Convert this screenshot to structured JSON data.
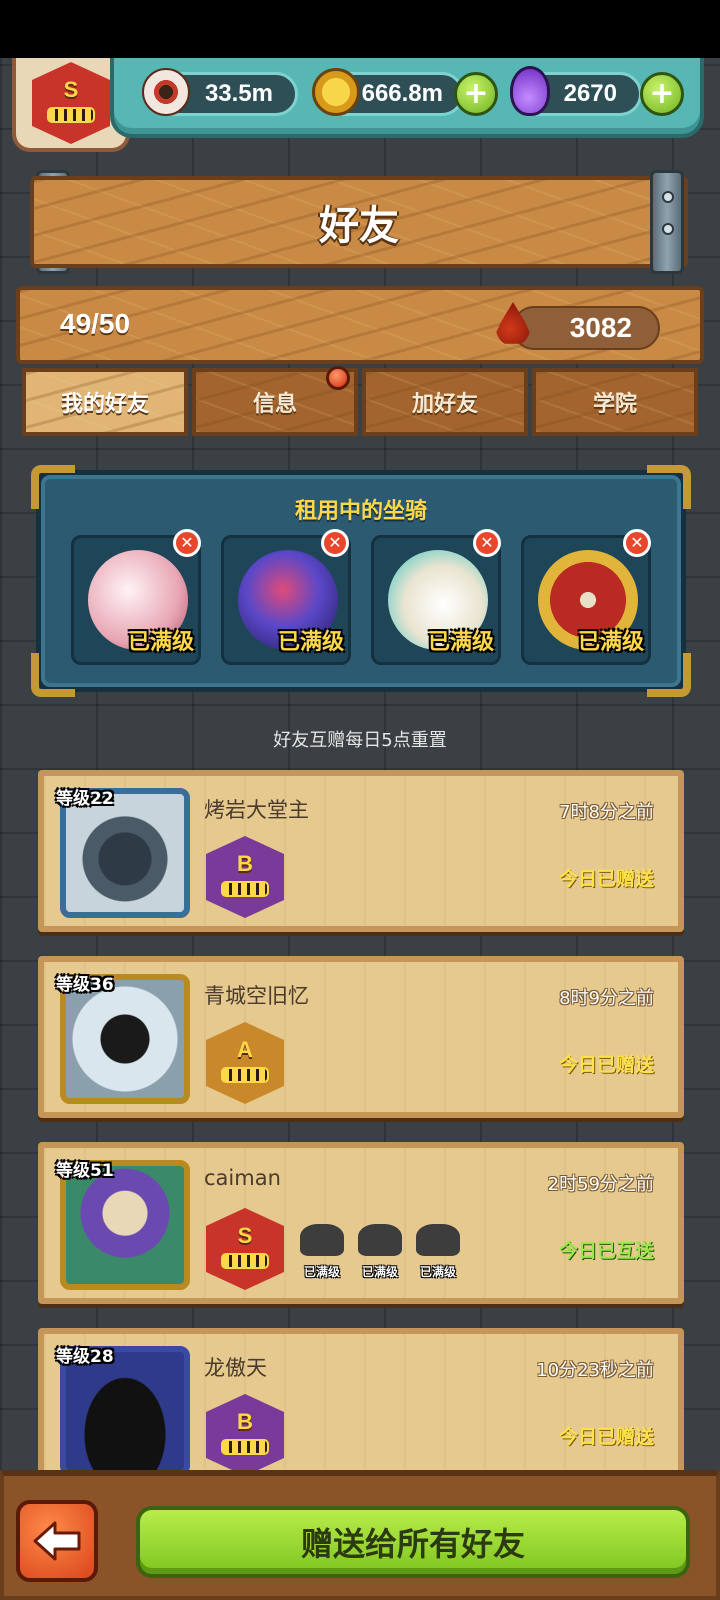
{
  "resources": {
    "eyeballs": "33.5m",
    "coins": "666.8m",
    "potions": "2670",
    "player_rank_letter": "S"
  },
  "page_title": "好友",
  "friend_count": "49/50",
  "blood_points": "3082",
  "tabs": [
    {
      "label": "我的好友",
      "active": true
    },
    {
      "label": "信息",
      "active": false,
      "has_notification": true
    },
    {
      "label": "加好友",
      "active": false
    },
    {
      "label": "学院",
      "active": false
    }
  ],
  "rented_mounts": {
    "title": "租用中的坐骑",
    "slots": [
      {
        "level_label": "已满级",
        "color": "#e8a6b4"
      },
      {
        "level_label": "已满级",
        "color": "#5a48c8"
      },
      {
        "level_label": "已满级",
        "color": "#e9e4d0"
      },
      {
        "level_label": "已满级",
        "color": "#b82a22"
      }
    ]
  },
  "reset_note": "好友互赠每日5点重置",
  "friends": [
    {
      "level": "等级22",
      "name": "烤岩大堂主",
      "time": "7时8分之前",
      "status": "今日已赠送",
      "rank": "B",
      "rank_color": "#7a3a9a",
      "status_color": "#ffe14a",
      "portrait_color": "#4a5a66",
      "mounts": []
    },
    {
      "level": "等级36",
      "name": "青城空旧忆",
      "time": "8时9分之前",
      "status": "今日已赠送",
      "rank": "A",
      "rank_color": "#c9892a",
      "status_color": "#ffe14a",
      "portrait_color": "#d9e6ee",
      "mounts": []
    },
    {
      "level": "等级51",
      "name": "caiman",
      "time": "2时59分之前",
      "status": "今日已互送",
      "rank": "S",
      "rank_color": "#c8332a",
      "status_color": "#9be84a",
      "portrait_color": "#6a4ab0",
      "mounts": [
        "已满级",
        "已满级",
        "已满级"
      ]
    },
    {
      "level": "等级28",
      "name": "龙傲天",
      "time": "10分23秒之前",
      "status": "今日已赠送",
      "rank": "B",
      "rank_color": "#7a3a9a",
      "status_color": "#ffe14a",
      "portrait_color": "#2e3a8a",
      "mounts": []
    }
  ],
  "bottom": {
    "send_all_label": "赠送给所有好友"
  }
}
